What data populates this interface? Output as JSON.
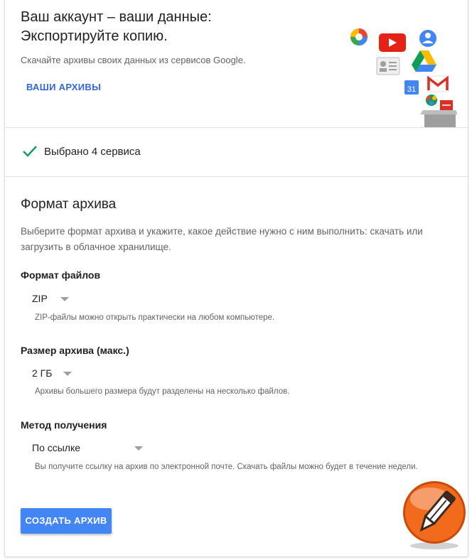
{
  "header": {
    "title_line1": "Ваш аккаунт – ваши данные:",
    "title_line2": "Экспортируйте копию.",
    "subtitle": "Скачайте архивы своих данных из сервисов Google.",
    "archives_link": "ВАШИ АРХИВЫ",
    "calendar_day": "31"
  },
  "selection": {
    "status": "Выбрано 4 сервиса"
  },
  "archive_format": {
    "title": "Формат архива",
    "description": "Выберите формат архива и укажите, какое действие нужно с ним выполнить: скачать или загрузить в облачное хранилище.",
    "file_type": {
      "label": "Формат файлов",
      "value": "ZIP",
      "hint": "ZIP-файлы можно открыть практически на любом компьютере."
    },
    "archive_size": {
      "label": "Размер архива (макс.)",
      "value": "2 ГБ",
      "hint": "Архивы большего размера будут разделены на несколько файлов."
    },
    "delivery_method": {
      "label": "Метод получения",
      "value": "По ссылке",
      "hint": "Вы получите ссылку на архив по электронной почте. Скачать файлы можно будет в течение недели."
    },
    "create_button": "СОЗДАТЬ АРХИВ"
  },
  "colors": {
    "accent_blue": "#4285f4",
    "link_blue": "#3367d6",
    "check_green": "#0f9d58",
    "logo_orange": "#f26b1d"
  }
}
